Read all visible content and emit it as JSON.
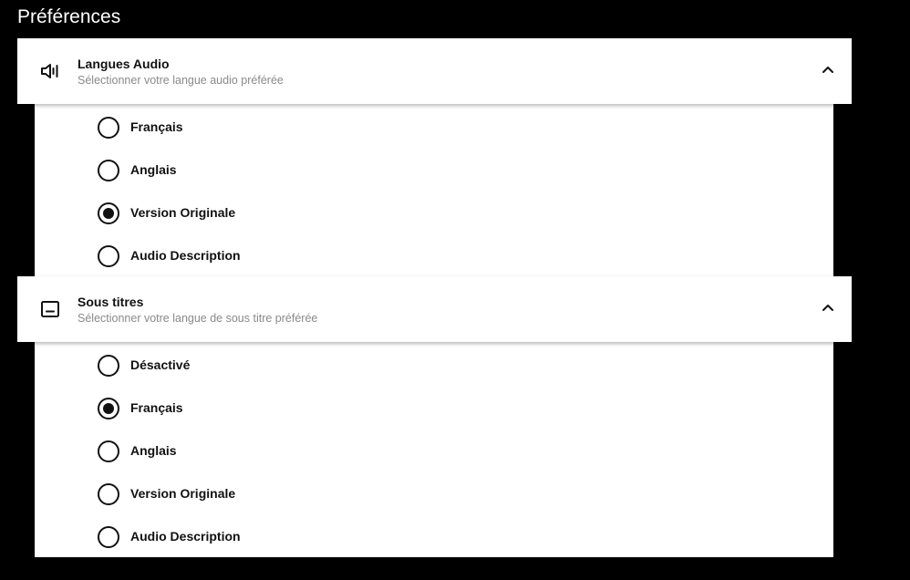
{
  "page": {
    "title": "Préférences"
  },
  "colors": {
    "background": "#000000",
    "panel": "#ffffff",
    "text": "#111111",
    "muted": "#8a8a8a"
  },
  "audio": {
    "title": "Langues Audio",
    "subtitle": "Sélectionner votre langue audio préférée",
    "icon": "speaker-icon",
    "expanded": true,
    "options": [
      {
        "label": "Français",
        "checked": false
      },
      {
        "label": "Anglais",
        "checked": false
      },
      {
        "label": "Version Originale",
        "checked": true
      },
      {
        "label": "Audio Description",
        "checked": false
      }
    ]
  },
  "subtitles": {
    "title": "Sous titres",
    "subtitle": "Sélectionner votre langue de sous titre préférée",
    "icon": "subtitles-icon",
    "expanded": true,
    "options": [
      {
        "label": "Désactivé",
        "checked": false
      },
      {
        "label": "Français",
        "checked": true
      },
      {
        "label": "Anglais",
        "checked": false
      },
      {
        "label": "Version Originale",
        "checked": false
      },
      {
        "label": "Audio Description",
        "checked": false
      }
    ]
  }
}
